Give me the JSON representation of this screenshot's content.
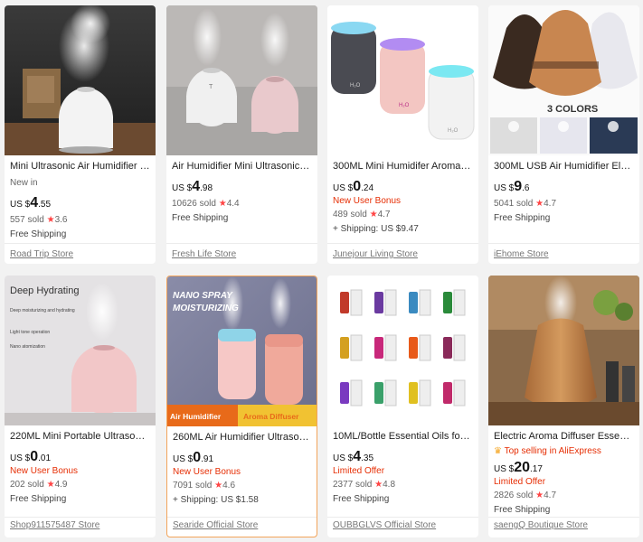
{
  "products": [
    {
      "title": "Mini Ultrasonic Air Humidifier LED ...",
      "tag": "New in",
      "price_cur": "US $",
      "price_int": "4",
      "price_dec": ".55",
      "sold": "557 sold",
      "rating": "3.6",
      "shipping": "Free Shipping",
      "store": "Road Trip Store"
    },
    {
      "title": "Air Humidifier Mini Ultrasonic USB...",
      "price_cur": "US $",
      "price_int": "4",
      "price_dec": ".98",
      "sold": "10626 sold",
      "rating": "4.4",
      "shipping": "Free Shipping",
      "store": "Fresh Life Store"
    },
    {
      "title": "300ML Mini Humidifer Aroma Esse...",
      "price_cur": "US $",
      "price_int": "0",
      "price_dec": ".24",
      "promo": "New User Bonus",
      "sold": "489 sold",
      "rating": "4.7",
      "shipping": "+ Shipping: US $9.47",
      "store": "Junejour Living Store"
    },
    {
      "title": "300ML USB Air Humidifier Electric ...",
      "price_cur": "US $",
      "price_int": "9",
      "price_dec": ".6",
      "sold": "5041 sold",
      "rating": "4.7",
      "shipping": "Free Shipping",
      "store": "iEhome Store",
      "img_text": "3 COLORS"
    },
    {
      "title": "220ML Mini Portable Ultrasonic Air...",
      "price_cur": "US $",
      "price_int": "0",
      "price_dec": ".01",
      "promo": "New User Bonus",
      "sold": "202 sold",
      "rating": "4.9",
      "shipping": "Free Shipping",
      "store": "Shop911575487 Store",
      "img_heading": "Deep Hydrating",
      "img_lines": [
        "Deep moisturizing and hydrating",
        "Light tone operation",
        "Nano atomization"
      ]
    },
    {
      "title": "260ML Air Humidifier Ultrasonic M...",
      "price_cur": "US $",
      "price_int": "0",
      "price_dec": ".91",
      "promo": "New User Bonus",
      "sold": "7091 sold",
      "rating": "4.6",
      "shipping": "+ Shipping: US $1.58",
      "store": "Searide Official Store",
      "img_heading": "NANO SPRAY MOISTURIZING",
      "img_left": "Air Humidifier",
      "img_right": "Aroma Diffuser"
    },
    {
      "title": "10ML/Bottle Essential Oils for aro...",
      "price_cur": "US $",
      "price_int": "4",
      "price_dec": ".35",
      "promo": "Limited Offer",
      "sold": "2377 sold",
      "rating": "4.8",
      "shipping": "Free Shipping",
      "store": "OUBBGLVS Official Store"
    },
    {
      "title": "Electric Aroma Diffuser Essential oi...",
      "top": "Top selling in AliExpress",
      "price_cur": "US $",
      "price_int": "20",
      "price_dec": ".17",
      "promo": "Limited Offer",
      "sold": "2826 sold",
      "rating": "4.7",
      "shipping": "Free Shipping",
      "store": "saengQ Boutique Store"
    }
  ]
}
